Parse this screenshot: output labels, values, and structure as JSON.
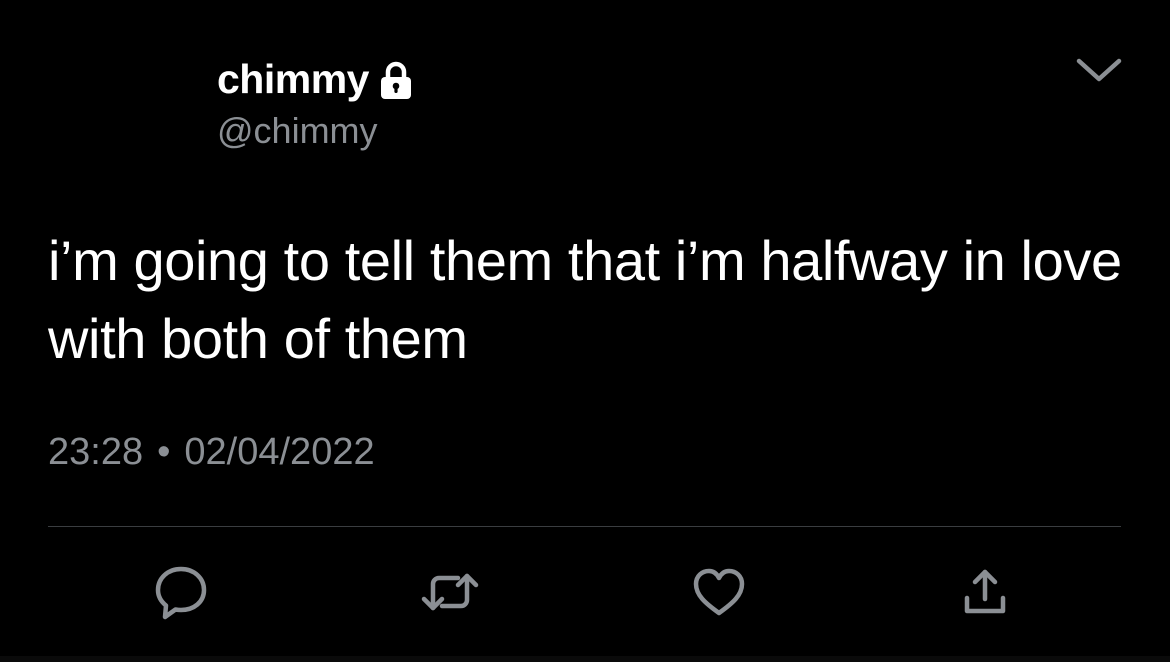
{
  "user": {
    "display_name": "chimmy",
    "handle": "@chimmy",
    "protected_icon": "lock-icon"
  },
  "tweet": {
    "text": "i’m going to tell them that i’m halfway in love with both of them",
    "time": "23:28",
    "separator": "•",
    "date": "02/04/2022"
  },
  "menu_icon": "chevron-down-icon",
  "actions": [
    {
      "name": "reply",
      "icon": "reply-icon"
    },
    {
      "name": "retweet",
      "icon": "retweet-icon"
    },
    {
      "name": "like",
      "icon": "heart-icon"
    },
    {
      "name": "share",
      "icon": "share-icon"
    }
  ],
  "colors": {
    "background": "#000000",
    "primary_text": "#ffffff",
    "secondary_text": "#8b8f94",
    "divider": "#3a3d40"
  }
}
